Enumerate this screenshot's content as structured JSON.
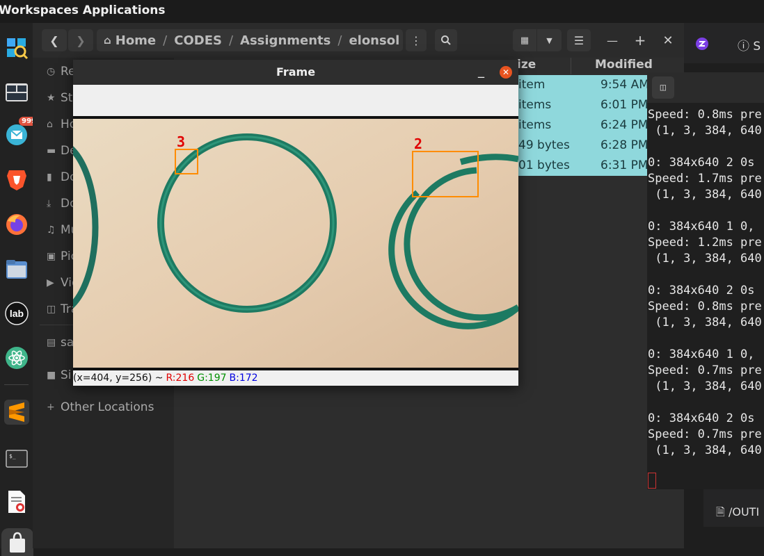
{
  "topbar": {
    "app_menu": "Workspaces Applications"
  },
  "dock": {
    "mail_badge": "999",
    "jupyter_label": "lab"
  },
  "file_manager": {
    "breadcrumb": [
      "Home",
      "CODES",
      "Assignments",
      "elonsol"
    ],
    "sidebar": [
      {
        "label": "Recent"
      },
      {
        "label": "Starred"
      },
      {
        "label": "Home"
      },
      {
        "label": "Desktop"
      },
      {
        "label": "Documents"
      },
      {
        "label": "Downloads"
      },
      {
        "label": "Music"
      },
      {
        "label": "Pictures"
      },
      {
        "label": "Videos"
      },
      {
        "label": "Trash"
      },
      {
        "label": "sa"
      },
      {
        "label": "Si"
      },
      {
        "label": "Other Locations"
      }
    ],
    "columns": {
      "size": "ize",
      "modified": "Modified"
    },
    "rows": [
      {
        "size": "item",
        "modified": "9:54 AM"
      },
      {
        "size": "items",
        "modified": "6:01 PM"
      },
      {
        "size": "items",
        "modified": "6:24 PM"
      },
      {
        "size": "49 bytes",
        "modified": "6:28 PM"
      },
      {
        "size": "01 bytes",
        "modified": "6:31 PM"
      }
    ]
  },
  "frame": {
    "title": "Frame",
    "labels": {
      "left_box": "3",
      "right_box": "2"
    },
    "box_color": "#ff8c00",
    "label_color": "#e00000",
    "status": {
      "coords": "(x=404, y=256) ~",
      "r": "R:216",
      "g": "G:197",
      "b": "B:172"
    }
  },
  "terminal": {
    "lines": [
      "Speed: 0.8ms pre",
      " (1, 3, 384, 640",
      "",
      "0: 384x640 2 0s",
      "Speed: 1.7ms pre",
      " (1, 3, 384, 640",
      "",
      "0: 384x640 1 0,",
      "Speed: 1.2ms pre",
      " (1, 3, 384, 640",
      "",
      "0: 384x640 2 0s",
      "Speed: 0.8ms pre",
      " (1, 3, 384, 640",
      "",
      "0: 384x640 1 0,",
      "Speed: 0.7ms pre",
      " (1, 3, 384, 640",
      "",
      "0: 384x640 2 0s",
      "Speed: 0.7ms pre",
      " (1, 3, 384, 640"
    ]
  },
  "right_panel": {
    "tab_label": "S",
    "file_label": "/OUTI"
  }
}
